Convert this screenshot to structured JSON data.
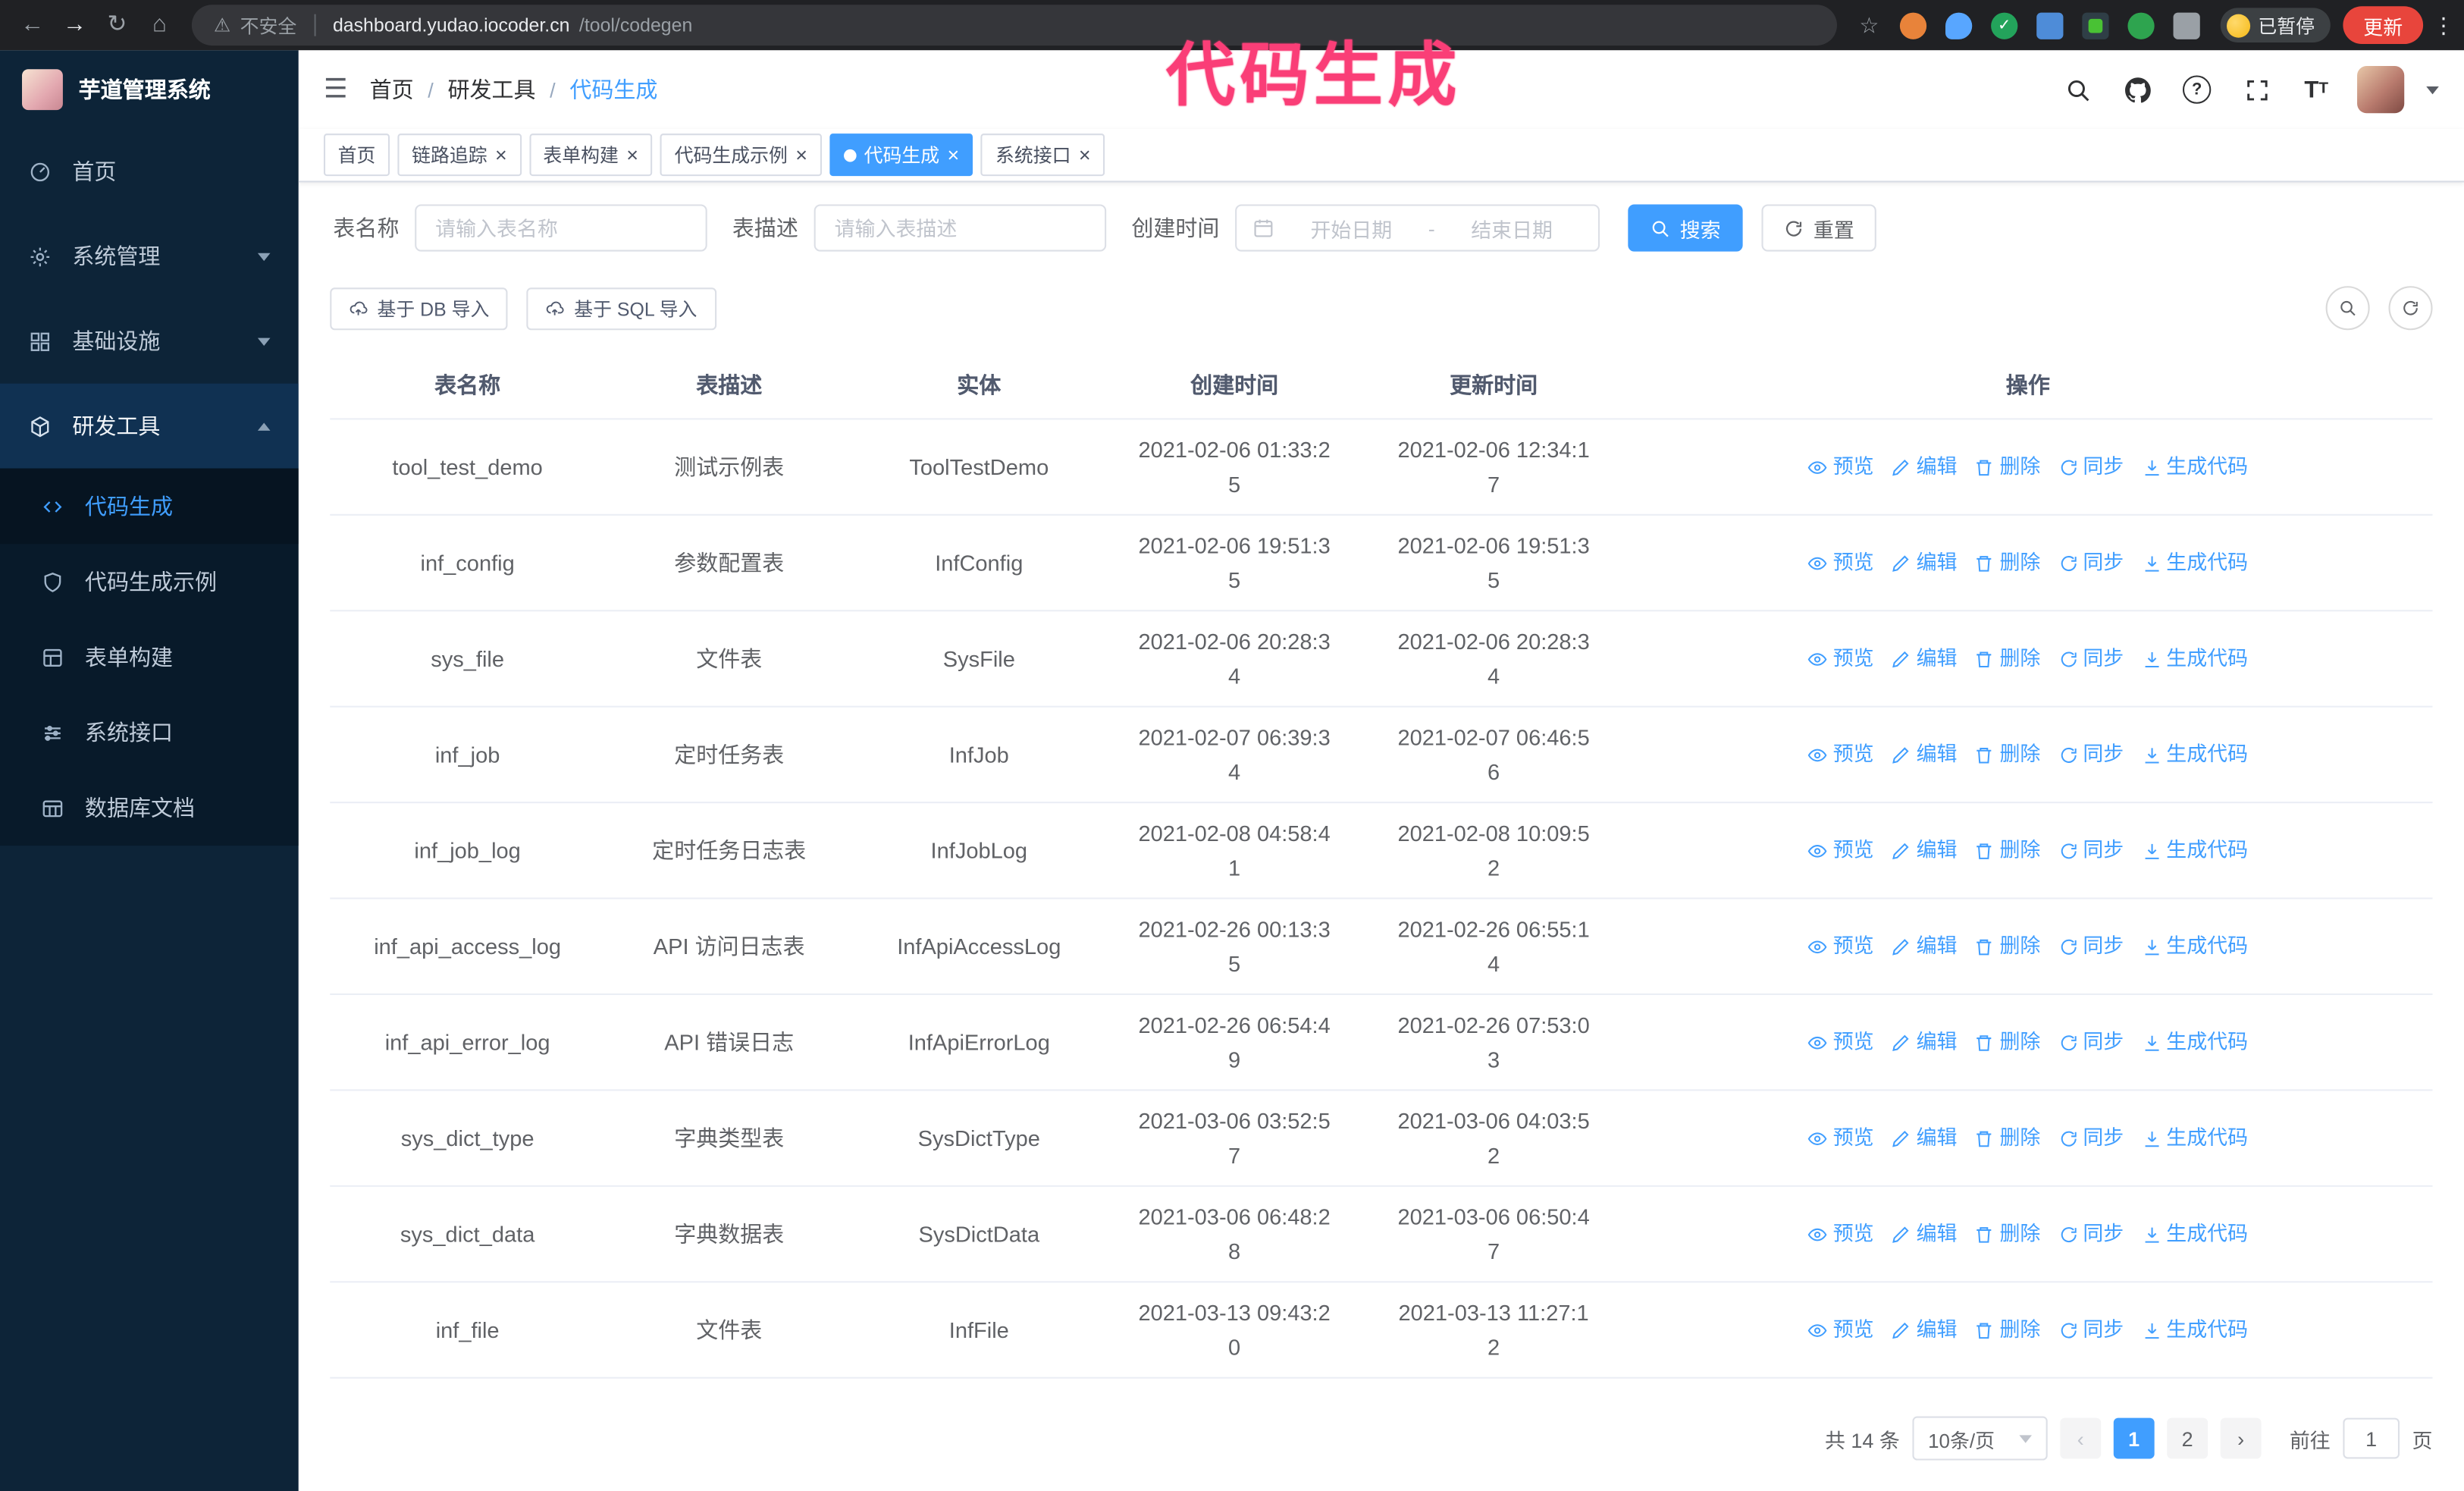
{
  "colors": {
    "accent": "#409eff",
    "sidebar_bg": "#0d2438",
    "chrome_bg": "#202124",
    "annotation": "#fa3e77",
    "update_button": "#e8453c",
    "active_tab_bg": "#409eff"
  },
  "browser": {
    "security_label": "不安全",
    "url_host": "dashboard.yudao.iocoder.cn",
    "url_path": "/tool/codegen",
    "paused_badge": "已暂停",
    "update_button": "更新"
  },
  "annotation": {
    "text": "代码生成"
  },
  "sidebar": {
    "logo_title": "芋道管理系统",
    "items": [
      {
        "label": "首页"
      },
      {
        "label": "系统管理"
      },
      {
        "label": "基础设施"
      },
      {
        "label": "研发工具"
      }
    ],
    "submenu": [
      {
        "label": "代码生成"
      },
      {
        "label": "代码生成示例"
      },
      {
        "label": "表单构建"
      },
      {
        "label": "系统接口"
      },
      {
        "label": "数据库文档"
      }
    ]
  },
  "header": {
    "breadcrumb": [
      "首页",
      "研发工具",
      "代码生成"
    ]
  },
  "tabs": [
    {
      "label": "首页"
    },
    {
      "label": "链路追踪"
    },
    {
      "label": "表单构建"
    },
    {
      "label": "代码生成示例"
    },
    {
      "label": "代码生成"
    },
    {
      "label": "系统接口"
    }
  ],
  "filters": {
    "table_name_label": "表名称",
    "table_name_placeholder": "请输入表名称",
    "table_desc_label": "表描述",
    "table_desc_placeholder": "请输入表描述",
    "create_time_label": "创建时间",
    "date_start_placeholder": "开始日期",
    "date_separator": "-",
    "date_end_placeholder": "结束日期",
    "search_button": "搜索",
    "reset_button": "重置"
  },
  "toolbar": {
    "import_db": "基于 DB 导入",
    "import_sql": "基于 SQL 导入"
  },
  "table": {
    "columns": [
      "表名称",
      "表描述",
      "实体",
      "创建时间",
      "更新时间",
      "操作"
    ],
    "actions": [
      "预览",
      "编辑",
      "删除",
      "同步",
      "生成代码"
    ],
    "rows": [
      {
        "name": "tool_test_demo",
        "desc": "测试示例表",
        "entity": "ToolTestDemo",
        "created": "2021-02-06 01:33:25",
        "updated": "2021-02-06 12:34:17"
      },
      {
        "name": "inf_config",
        "desc": "参数配置表",
        "entity": "InfConfig",
        "created": "2021-02-06 19:51:35",
        "updated": "2021-02-06 19:51:35"
      },
      {
        "name": "sys_file",
        "desc": "文件表",
        "entity": "SysFile",
        "created": "2021-02-06 20:28:34",
        "updated": "2021-02-06 20:28:34"
      },
      {
        "name": "inf_job",
        "desc": "定时任务表",
        "entity": "InfJob",
        "created": "2021-02-07 06:39:34",
        "updated": "2021-02-07 06:46:56"
      },
      {
        "name": "inf_job_log",
        "desc": "定时任务日志表",
        "entity": "InfJobLog",
        "created": "2021-02-08 04:58:41",
        "updated": "2021-02-08 10:09:52"
      },
      {
        "name": "inf_api_access_log",
        "desc": "API 访问日志表",
        "entity": "InfApiAccessLog",
        "created": "2021-02-26 00:13:35",
        "updated": "2021-02-26 06:55:14"
      },
      {
        "name": "inf_api_error_log",
        "desc": "API 错误日志",
        "entity": "InfApiErrorLog",
        "created": "2021-02-26 06:54:49",
        "updated": "2021-02-26 07:53:03"
      },
      {
        "name": "sys_dict_type",
        "desc": "字典类型表",
        "entity": "SysDictType",
        "created": "2021-03-06 03:52:57",
        "updated": "2021-03-06 04:03:52"
      },
      {
        "name": "sys_dict_data",
        "desc": "字典数据表",
        "entity": "SysDictData",
        "created": "2021-03-06 06:48:28",
        "updated": "2021-03-06 06:50:47"
      },
      {
        "name": "inf_file",
        "desc": "文件表",
        "entity": "InfFile",
        "created": "2021-03-13 09:43:20",
        "updated": "2021-03-13 11:27:12"
      }
    ]
  },
  "pagination": {
    "total": "共 14 条",
    "page_size": "10条/页",
    "pages": [
      "1",
      "2"
    ],
    "active_page": "1",
    "jump_prefix": "前往",
    "jump_value": "1",
    "jump_suffix": "页"
  },
  "icons": {
    "search": "magnifier",
    "github": "octocat",
    "help": "question-circle",
    "fullscreen": "expand-corners",
    "font_size": "Tt",
    "hamburger": "menu-lines",
    "refresh": "circular-arrow",
    "calendar": "calendar",
    "import": "cloud-upload",
    "preview": "eye",
    "edit": "pencil",
    "delete": "trash",
    "sync": "sync-arrows",
    "generate": "download"
  }
}
